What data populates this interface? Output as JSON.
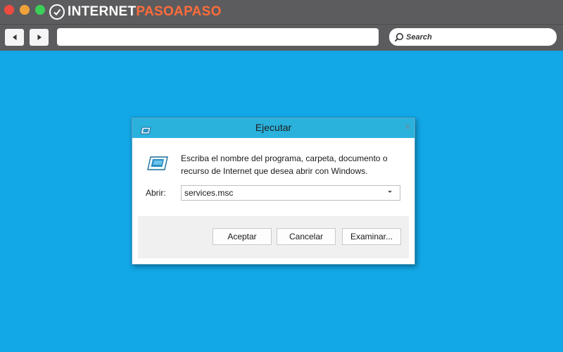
{
  "browser": {
    "brand_part1": "INTERNET",
    "brand_part2": "PASOAPASO",
    "address_value": "",
    "search_label": "Search",
    "colors": {
      "chrome": "#5c5c5e",
      "desktop": "#12a7e6",
      "brand_accent": "#ff6c3b"
    }
  },
  "icons": {
    "back": "arrow-left-icon",
    "forward": "arrow-right-icon",
    "search": "magnifier-icon",
    "run": "run-program-icon",
    "close": "close-icon",
    "dropdown": "chevron-down-icon"
  },
  "dialog": {
    "title": "Ejecutar",
    "close_glyph": "×",
    "description_line1": "Escriba el nombre del programa, carpeta, documento o",
    "description_line2": "recurso de Internet que desea abrir con Windows.",
    "open_label": "Abrir:",
    "open_value": "services.msc",
    "buttons": {
      "ok": "Aceptar",
      "cancel": "Cancelar",
      "browse": "Examinar..."
    },
    "colors": {
      "titlebar": "#2ab2dd",
      "button_area": "#f0f0f0"
    }
  }
}
